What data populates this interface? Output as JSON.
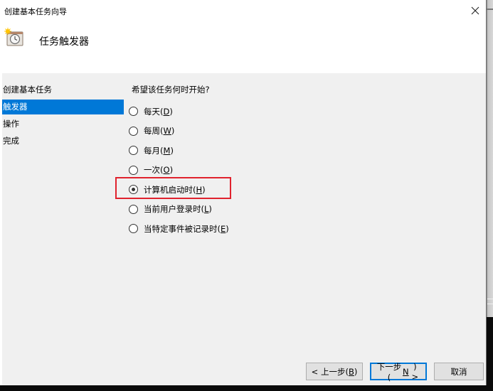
{
  "window": {
    "title": "创建基本任务向导",
    "close_icon": "close-icon"
  },
  "header": {
    "title": "任务触发器",
    "icon": "clock-task-icon"
  },
  "sidebar": {
    "items": [
      {
        "label": "创建基本任务",
        "selected": false
      },
      {
        "label": "触发器",
        "selected": true
      },
      {
        "label": "操作",
        "selected": false
      },
      {
        "label": "完成",
        "selected": false
      }
    ]
  },
  "main": {
    "question": "希望该任务何时开始?",
    "options": [
      {
        "label": "每天",
        "accel": "D",
        "checked": false
      },
      {
        "label": "每周",
        "accel": "W",
        "checked": false
      },
      {
        "label": "每月",
        "accel": "M",
        "checked": false
      },
      {
        "label": "一次",
        "accel": "O",
        "checked": false
      },
      {
        "label": "计算机启动时",
        "accel": "H",
        "checked": true
      },
      {
        "label": "当前用户登录时",
        "accel": "L",
        "checked": false
      },
      {
        "label": "当特定事件被记录时",
        "accel": "E",
        "checked": false
      }
    ],
    "highlight_color": "#e0222d"
  },
  "footer": {
    "back_label": "< 上一步(",
    "back_accel": "B",
    "back_suffix": ")",
    "next_label": "下一步(",
    "next_accel": "N",
    "next_suffix": ") >",
    "cancel_label": "取消"
  },
  "colors": {
    "selection": "#0078d7",
    "body_bg": "#f0f0f0"
  }
}
